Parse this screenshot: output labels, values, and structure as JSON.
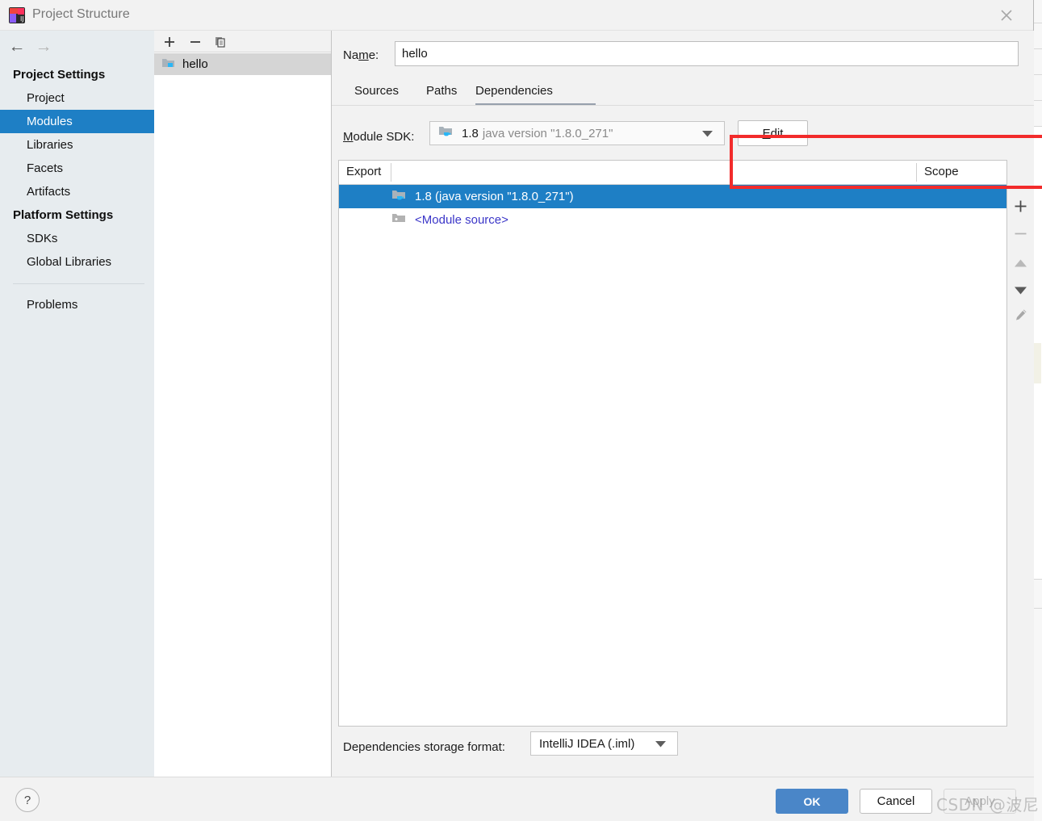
{
  "window": {
    "title": "Project Structure",
    "app_icon": "intellij-idea-icon",
    "close_icon": "close-icon"
  },
  "nav": {
    "back_icon": "arrow-left-icon",
    "forward_icon": "arrow-right-icon"
  },
  "sidebar": {
    "groups": [
      {
        "label": "Project Settings",
        "items": [
          {
            "label": "Project",
            "selected": false
          },
          {
            "label": "Modules",
            "selected": true
          },
          {
            "label": "Libraries",
            "selected": false
          },
          {
            "label": "Facets",
            "selected": false
          },
          {
            "label": "Artifacts",
            "selected": false
          }
        ]
      },
      {
        "label": "Platform Settings",
        "items": [
          {
            "label": "SDKs",
            "selected": false
          },
          {
            "label": "Global Libraries",
            "selected": false
          }
        ]
      }
    ],
    "problems_label": "Problems"
  },
  "modules_pane": {
    "toolbar": {
      "add_icon": "plus-icon",
      "remove_icon": "minus-icon",
      "copy_icon": "copy-icon"
    },
    "items": [
      {
        "label": "hello",
        "icon": "module-folder-icon",
        "selected": true
      }
    ]
  },
  "main": {
    "name_label": "Name:",
    "name_mnemonic": "m",
    "name_value": "hello",
    "tabs": [
      {
        "label": "Sources",
        "selected": false
      },
      {
        "label": "Paths",
        "selected": false
      },
      {
        "label": "Dependencies",
        "selected": true
      }
    ],
    "sdk": {
      "label_prefix": "",
      "label": "Module SDK:",
      "label_mnemonic": "M",
      "icon": "jdk-folder-icon",
      "version": "1.8",
      "description": "java version \"1.8.0_271\"",
      "dropdown_icon": "chevron-down-icon",
      "edit_button": "Edit",
      "edit_mnemonic": "E"
    },
    "table": {
      "columns": [
        "Export",
        "Scope"
      ],
      "rows": [
        {
          "export": "",
          "name": "1.8 (java version \"1.8.0_271\")",
          "scope": "",
          "icon": "jdk-folder-icon",
          "selected": true,
          "link": false
        },
        {
          "export": "",
          "name": "<Module source>",
          "scope": "",
          "icon": "module-source-folder-icon",
          "selected": false,
          "link": true
        }
      ]
    },
    "table_toolbar": {
      "add_icon": "plus-icon",
      "remove_icon": "minus-icon",
      "up_icon": "arrow-up-icon",
      "down_icon": "arrow-down-icon",
      "edit_icon": "pencil-icon"
    },
    "storage": {
      "label": "Dependencies storage format:",
      "value": "IntelliJ IDEA (.iml)",
      "dropdown_icon": "chevron-down-icon"
    }
  },
  "footer": {
    "help_label": "?",
    "ok_label": "OK",
    "cancel_label": "Cancel",
    "apply_label": "Apply"
  },
  "annotation": {
    "color": "#f22b2b"
  },
  "watermark": {
    "text": "CSDN @波尼"
  },
  "colors": {
    "selection_blue": "#1e7fc5",
    "primary_button": "#4a86c8",
    "sidebar_bg": "#e7ecef",
    "dialog_bg": "#f2f2f2",
    "link_text": "#3b36c8"
  }
}
